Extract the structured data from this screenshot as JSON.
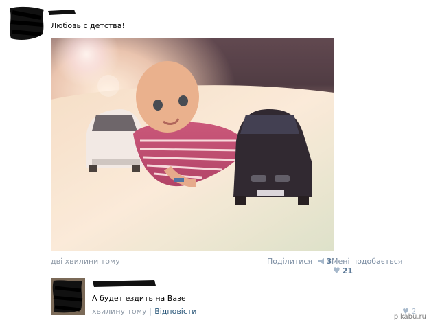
{
  "post": {
    "text": "Любовь с детства!",
    "time": "дві хвилини тому",
    "share_label": "Поділитися",
    "share_count": "3",
    "like_label": "Мені подобається",
    "like_count": "21"
  },
  "comment": {
    "text": "А будет ездить на Вазе",
    "time": "хвилину тому",
    "separator": "|",
    "reply_label": "Відповісти",
    "like_count": "2"
  },
  "watermark": "pikabu.ru",
  "icons": {
    "share": "megaphone-icon",
    "like": "heart-icon"
  },
  "colors": {
    "link": "#2b587a",
    "meta": "#8f9aa7",
    "count": "#5e7b99",
    "divider": "#dae1e8"
  }
}
